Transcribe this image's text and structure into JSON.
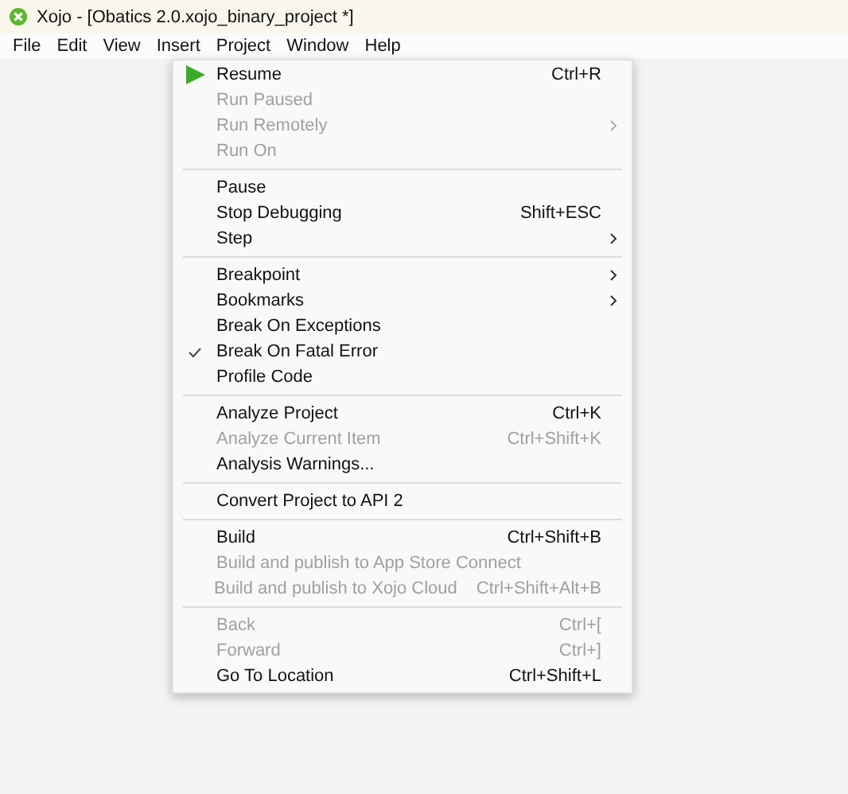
{
  "window": {
    "title": "Xojo - [Obatics 2.0.xojo_binary_project *]"
  },
  "menu_bar": [
    "File",
    "Edit",
    "View",
    "Insert",
    "Project",
    "Window",
    "Help"
  ],
  "menu": {
    "groups": [
      {
        "items": [
          {
            "label": "Resume",
            "shortcut": "Ctrl+R",
            "disabled": false,
            "checked": false,
            "submenu": false
          },
          {
            "label": "Run Paused",
            "disabled": true,
            "checked": false,
            "submenu": false
          },
          {
            "label": "Run Remotely",
            "disabled": true,
            "checked": false,
            "submenu": true
          },
          {
            "label": "Run On",
            "disabled": true,
            "checked": false,
            "submenu": false
          }
        ]
      },
      {
        "items": [
          {
            "label": "Pause",
            "disabled": false,
            "checked": false,
            "submenu": false
          },
          {
            "label": "Stop Debugging",
            "shortcut": "Shift+ESC",
            "disabled": false,
            "checked": false,
            "submenu": false
          },
          {
            "label": "Step",
            "disabled": false,
            "checked": false,
            "submenu": true
          }
        ]
      },
      {
        "items": [
          {
            "label": "Breakpoint",
            "disabled": false,
            "checked": false,
            "submenu": true
          },
          {
            "label": "Bookmarks",
            "disabled": false,
            "checked": false,
            "submenu": true
          },
          {
            "label": "Break On Exceptions",
            "disabled": false,
            "checked": false,
            "submenu": false
          },
          {
            "label": "Break On Fatal Error",
            "disabled": false,
            "checked": true,
            "submenu": false
          },
          {
            "label": "Profile Code",
            "disabled": false,
            "checked": false,
            "submenu": false
          }
        ]
      },
      {
        "items": [
          {
            "label": "Analyze Project",
            "shortcut": "Ctrl+K",
            "disabled": false,
            "checked": false,
            "submenu": false
          },
          {
            "label": "Analyze Current Item",
            "shortcut": "Ctrl+Shift+K",
            "disabled": true,
            "checked": false,
            "submenu": false
          },
          {
            "label": "Analysis Warnings...",
            "disabled": false,
            "checked": false,
            "submenu": false
          }
        ]
      },
      {
        "items": [
          {
            "label": "Convert Project to API 2",
            "disabled": false,
            "checked": false,
            "submenu": false
          }
        ]
      },
      {
        "items": [
          {
            "label": "Build",
            "shortcut": "Ctrl+Shift+B",
            "disabled": false,
            "checked": false,
            "submenu": false
          },
          {
            "label": "Build and publish to App Store Connect",
            "disabled": true,
            "checked": false,
            "submenu": false
          },
          {
            "label": "Build and publish to Xojo Cloud",
            "shortcut": "Ctrl+Shift+Alt+B",
            "disabled": true,
            "checked": false,
            "submenu": false
          }
        ]
      },
      {
        "items": [
          {
            "label": "Back",
            "shortcut": "Ctrl+[",
            "disabled": true,
            "checked": false,
            "submenu": false
          },
          {
            "label": "Forward",
            "shortcut": "Ctrl+]",
            "disabled": true,
            "checked": false,
            "submenu": false
          },
          {
            "label": "Go To Location",
            "shortcut": "Ctrl+Shift+L",
            "disabled": false,
            "checked": false,
            "submenu": false
          }
        ]
      }
    ]
  }
}
